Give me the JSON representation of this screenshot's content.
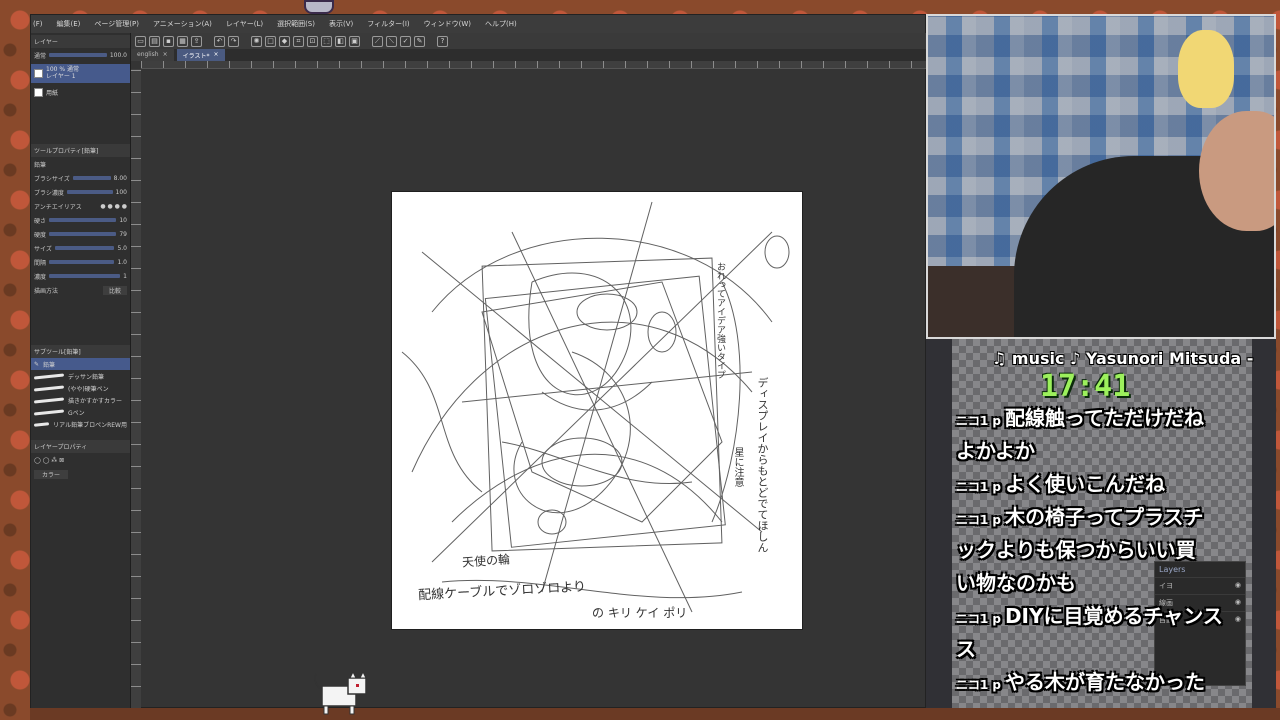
{
  "menu": [
    "(F)",
    "編集(E)",
    "ページ管理(P)",
    "アニメーション(A)",
    "レイヤー(L)",
    "選択範囲(S)",
    "表示(V)",
    "フィルター(I)",
    "ウィンドウ(W)",
    "ヘルプ(H)"
  ],
  "tabs": [
    {
      "label": "english",
      "close": "×"
    },
    {
      "label": "イラスト*",
      "close": "×"
    }
  ],
  "side": {
    "layer_panel_title": "レイヤー",
    "blend_mode": "通常",
    "opacity_value": "100.0",
    "layers": [
      {
        "name": "100 % 通常\nレイヤー 1"
      },
      {
        "name": "用紙"
      }
    ],
    "tool_property_title": "ツールプロパティ[鉛筆]",
    "tool_name": "鉛筆",
    "props": [
      {
        "label": "ブラシサイズ",
        "value": "8.00"
      },
      {
        "label": "ブラシ濃度",
        "value": "100"
      },
      {
        "label": "アンチエイリアス",
        "value": ""
      },
      {
        "label": "硬さ",
        "value": "10"
      },
      {
        "label": "硬度",
        "value": "79"
      },
      {
        "label": "サイズ",
        "value": "5.0"
      },
      {
        "label": "間隔",
        "value": "1.0"
      },
      {
        "label": "濃度",
        "value": "1"
      }
    ],
    "blend_method_label": "描画方法",
    "blend_method_value": "比較",
    "subtool_title": "サブツール[鉛筆]",
    "subtool_active": "鉛筆",
    "subtools": [
      "デッサン鉛筆",
      "(やや)硬筆ペン",
      "描きかすかすカラー",
      "Gペン",
      "リアル鉛筆ブロペンREW用"
    ],
    "layer_property_title": "レイヤープロパティ",
    "color_label": "カラー"
  },
  "canvas": {
    "texts": [
      "おれってアイデア強いタイプ",
      "ディスプレイからもとどでてほしん",
      "星に注意",
      "天使の輪",
      "配線ケーブルでゾロゾロより",
      "の キリ ケイ ポリ"
    ]
  },
  "overlay": {
    "music": "♫ music ♪ Yasunori Mitsuda -",
    "time": "17:41",
    "nico_prefix": "ニコ1",
    "nico_suffix": "p",
    "comments": [
      {
        "text": "配線触ってただけだね",
        "prefixed": true
      },
      {
        "text": "よかよか",
        "prefixed": false
      },
      {
        "text": "よく使いこんだね",
        "prefixed": true
      },
      {
        "text": "木の椅子ってプラスチ",
        "prefixed": true
      },
      {
        "text": "ックよりも保つからいい買",
        "prefixed": false
      },
      {
        "text": "い物なのかも",
        "prefixed": false
      },
      {
        "text": "DIYに目覚めるチャンス",
        "prefixed": true
      },
      {
        "text": "ス",
        "prefixed": false
      },
      {
        "text": "やる木が育たなかった",
        "prefixed": true
      }
    ],
    "layers_panel": {
      "title": "Layers",
      "rows": [
        "イヨ",
        "線画",
        "自動"
      ]
    }
  }
}
